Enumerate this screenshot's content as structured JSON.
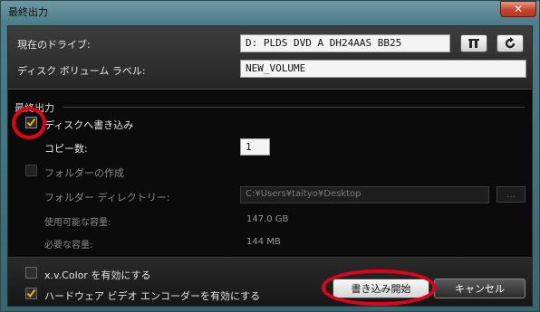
{
  "window": {
    "title": "最終出力",
    "close_label": "✕"
  },
  "drive": {
    "label": "現在のドライブ:",
    "value": "D: PLDS    DVD A  DH24AAS  BB25"
  },
  "volume": {
    "label": "ディスク ボリューム ラベル:",
    "value": "NEW_VOLUME"
  },
  "output": {
    "group_label": "最終出力",
    "write_to_disc_label": "ディスクへ書き込み",
    "copies_label": "コピー数:",
    "copies_value": "1",
    "create_folder_label": "フォルダーの作成",
    "folder_dir_label": "フォルダー ディレクトリー:",
    "folder_dir_value": "C:¥Users¥taityo¥Desktop",
    "browse_label": "...",
    "available_label": "使用可能な容量:",
    "available_value": "147.0 GB",
    "required_label": "必要な容量:",
    "required_value": "144 MB"
  },
  "options": {
    "xvcolor_label": "x.v.Color を有効にする",
    "hw_encoder_label": "ハードウェア ビデオ エンコーダーを有効にする"
  },
  "buttons": {
    "start_label": "書き込み開始",
    "cancel_label": "キャンセル"
  },
  "icons": [
    "drive-info-icon",
    "refresh-icon",
    "checkmark-icon"
  ],
  "colors": {
    "accent_check": "#e8b320",
    "annotation": "#e3001b",
    "frame": "#4d7e8c"
  }
}
